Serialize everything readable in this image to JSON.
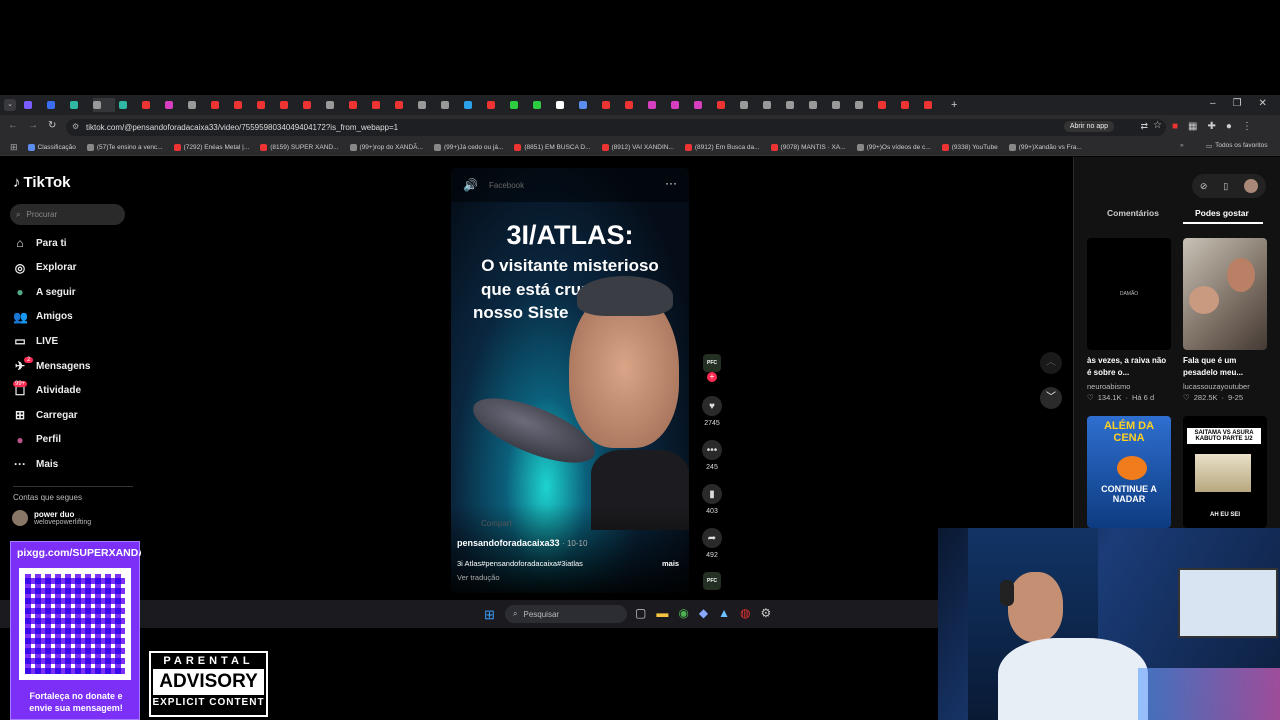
{
  "browser": {
    "url": "tiktok.com/@pensandoforadacaixa33/video/7559598034049404172?is_from_webapp=1",
    "open_app_label": "Abrir no app",
    "bookmarks": [
      {
        "label": "Classificação",
        "color": "#5b8def"
      },
      {
        "label": "(57)Te ensino a venc...",
        "color": "#888"
      },
      {
        "label": "(7292) Enéas Metal |...",
        "color": "#e33"
      },
      {
        "label": "(8159) SUPER XAND...",
        "color": "#e33"
      },
      {
        "label": "(99+)rop do XANDÃ...",
        "color": "#888"
      },
      {
        "label": "(99+)Já cedo ou já...",
        "color": "#888"
      },
      {
        "label": "(8851) EM BUSCA D...",
        "color": "#e33"
      },
      {
        "label": "(8912) VAI XANDIN...",
        "color": "#e33"
      },
      {
        "label": "(8912) Em Busca da...",
        "color": "#e33"
      },
      {
        "label": "(9078) MANTIS · XA...",
        "color": "#e33"
      },
      {
        "label": "(99+)Os vídeos de c...",
        "color": "#888"
      },
      {
        "label": "(9338) YouTube",
        "color": "#e33"
      },
      {
        "label": "(99+)Xandão vs Fra...",
        "color": "#888"
      }
    ],
    "all_favorites_label": "Todos os favoritos",
    "tab_colors": [
      "#7a5cff",
      "#3b6df0",
      "#2fb7a3",
      "#999",
      "#2fb7a3",
      "#e33",
      "#d63fbf",
      "#999",
      "#e33",
      "#e33",
      "#e33",
      "#e33",
      "#e33",
      "#999",
      "#e33",
      "#e33",
      "#e33",
      "#999",
      "#999",
      "#2aa1e8",
      "#e33",
      "#2ecc40",
      "#2ecc40",
      "#fff",
      "#5b8def",
      "#e33",
      "#e33",
      "#d63fbf",
      "#d63fbf",
      "#d63fbf",
      "#e33",
      "#999",
      "#999",
      "#999",
      "#999",
      "#999",
      "#999",
      "#e33",
      "#e33",
      "#e33"
    ]
  },
  "tiktok": {
    "logo": "TikTok",
    "search_placeholder": "Procurar",
    "nav": [
      {
        "label": "Para ti",
        "icon": "home-icon",
        "glyph": "⌂"
      },
      {
        "label": "Explorar",
        "icon": "compass-icon",
        "glyph": "◎"
      },
      {
        "label": "A seguir",
        "icon": "following-icon",
        "glyph": "●"
      },
      {
        "label": "Amigos",
        "icon": "friends-icon",
        "glyph": "👥"
      },
      {
        "label": "LIVE",
        "icon": "live-icon",
        "glyph": "▭"
      },
      {
        "label": "Mensagens",
        "icon": "messages-icon",
        "glyph": "✈"
      },
      {
        "label": "Atividade",
        "icon": "activity-icon",
        "glyph": "☐"
      },
      {
        "label": "Carregar",
        "icon": "upload-icon",
        "glyph": "⊞"
      },
      {
        "label": "Perfil",
        "icon": "profile-icon",
        "glyph": "●"
      },
      {
        "label": "Mais",
        "icon": "more-icon",
        "glyph": "···"
      }
    ],
    "messages_badge": "2",
    "activity_badge": "99+",
    "following_section_title": "Contas que segues",
    "following_account": {
      "name": "power duo",
      "handle": "welovepowerlifting"
    },
    "video": {
      "title": "3I/ATLAS:",
      "subtitle_line1": "O visitante misterioso",
      "subtitle_line2": "que está cruz",
      "subtitle_line2b": "o",
      "subtitle_line3": "nosso Siste",
      "overlay_source": "Facebook",
      "share_overlay": "Compart",
      "author": "pensandoforadacaixa33",
      "date": "10-10",
      "caption": "3i Atlas#pensandoforadacaixa#3iatlas",
      "more_label": "mais",
      "translate_label": "Ver tradução"
    },
    "actions": {
      "likes": "2745",
      "comments": "245",
      "saves": "403",
      "shares": "492"
    },
    "avatar_badge": "PFC",
    "right_panel": {
      "tabs": [
        "Comentários",
        "Podes gostar"
      ],
      "active_tab": "Podes gostar",
      "suggestions": [
        {
          "caption": "às vezes, a raiva não é sobre o...",
          "author": "neuroabismo",
          "likes": "134.1K",
          "date": "Há 6 d",
          "thumb_text": "DAMÃO"
        },
        {
          "caption": "Fala que é um pesadelo meu...",
          "author": "lucassouzayoutuber",
          "likes": "282.5K",
          "date": "9-25",
          "thumb_text": ""
        },
        {
          "caption": "",
          "author": "",
          "likes": "",
          "date": "",
          "thumb_text": "ALÉM DA CENA",
          "thumb_text2": "CONTINUE A NADAR"
        },
        {
          "caption": "",
          "author": "",
          "likes": "",
          "date": "",
          "thumb_text": "SAITAMA VS ASURA KABUTO PARTE 1/2",
          "thumb_text2": "AH EU SEI"
        }
      ]
    }
  },
  "taskbar": {
    "search_placeholder": "Pesquisar"
  },
  "overlay": {
    "donate_url": "pixgg.com/SUPERXANDA",
    "donate_text": "Fortaleça no donate e envie sua mensagem!",
    "advisory_line1": "PARENTAL",
    "advisory_line2": "ADVISORY",
    "advisory_line3": "EXPLICIT CONTENT"
  }
}
